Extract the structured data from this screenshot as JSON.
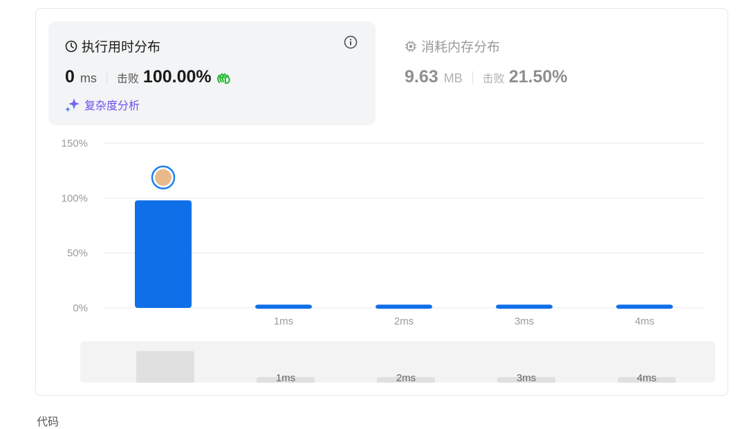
{
  "runtime": {
    "title": "执行用时分布",
    "value": "0",
    "unit": "ms",
    "beat_label": "击败",
    "beat_value": "100.00%",
    "complexity_link": "复杂度分析"
  },
  "memory": {
    "title": "消耗内存分布",
    "value": "9.63",
    "unit": "MB",
    "beat_label": "击败",
    "beat_value": "21.50%"
  },
  "colors": {
    "bar": "#0f6fe8",
    "accent_purple": "#6b4ef0",
    "clap_green": "#2cbb3b"
  },
  "chart_data": {
    "type": "bar",
    "categories": [
      "",
      "1ms",
      "2ms",
      "3ms",
      "4ms"
    ],
    "values": [
      98,
      3,
      3,
      3,
      3
    ],
    "ylim": [
      0,
      150
    ],
    "yticks": [
      0,
      50,
      100,
      150
    ],
    "ytick_labels": [
      "0%",
      "50%",
      "100%",
      "150%"
    ],
    "grid": true
  },
  "minimap": {
    "labels": [
      "1ms",
      "2ms",
      "3ms",
      "4ms"
    ]
  },
  "footer": {
    "text": "代码"
  }
}
